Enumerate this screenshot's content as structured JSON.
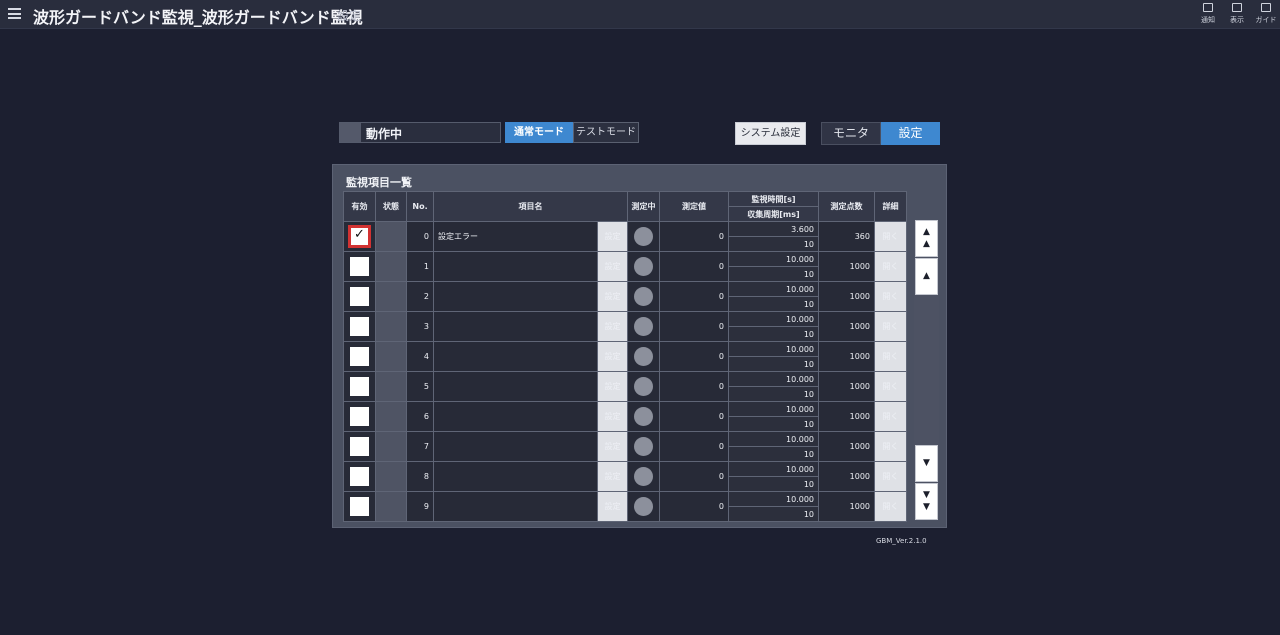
{
  "header": {
    "title": "波形ガードバンド監視_波形ガードバンド監視",
    "subtitle": "設定",
    "actions": [
      {
        "label": "通知",
        "icon": "notification-icon"
      },
      {
        "label": "表示",
        "icon": "display-icon"
      },
      {
        "label": "ガイド",
        "icon": "guide-icon"
      }
    ]
  },
  "status": {
    "text": "動作中"
  },
  "modes": {
    "normal": "通常モード",
    "test": "テストモード",
    "active": "normal"
  },
  "system_settings_label": "システム設定",
  "view_tabs": {
    "monitor": "モニタ",
    "settings": "設定",
    "active": "settings"
  },
  "panel": {
    "title": "監視項目一覧",
    "columns": {
      "enabled": "有効",
      "state": "状態",
      "no": "No.",
      "item_name": "項目名",
      "measuring": "測定中",
      "measured_value": "測定値",
      "monitor_time": "監視時間[s]",
      "sample_period": "収集周期[ms]",
      "points": "測定点数",
      "detail": "詳細"
    },
    "set_label": "設定",
    "open_label": "開く",
    "rows": [
      {
        "enabled": true,
        "no": "0",
        "name": "設定エラー",
        "value": "0",
        "monitor_time": "3.600",
        "sample_period": "10",
        "points": "360"
      },
      {
        "enabled": false,
        "no": "1",
        "name": "",
        "value": "0",
        "monitor_time": "10.000",
        "sample_period": "10",
        "points": "1000"
      },
      {
        "enabled": false,
        "no": "2",
        "name": "",
        "value": "0",
        "monitor_time": "10.000",
        "sample_period": "10",
        "points": "1000"
      },
      {
        "enabled": false,
        "no": "3",
        "name": "",
        "value": "0",
        "monitor_time": "10.000",
        "sample_period": "10",
        "points": "1000"
      },
      {
        "enabled": false,
        "no": "4",
        "name": "",
        "value": "0",
        "monitor_time": "10.000",
        "sample_period": "10",
        "points": "1000"
      },
      {
        "enabled": false,
        "no": "5",
        "name": "",
        "value": "0",
        "monitor_time": "10.000",
        "sample_period": "10",
        "points": "1000"
      },
      {
        "enabled": false,
        "no": "6",
        "name": "",
        "value": "0",
        "monitor_time": "10.000",
        "sample_period": "10",
        "points": "1000"
      },
      {
        "enabled": false,
        "no": "7",
        "name": "",
        "value": "0",
        "monitor_time": "10.000",
        "sample_period": "10",
        "points": "1000"
      },
      {
        "enabled": false,
        "no": "8",
        "name": "",
        "value": "0",
        "monitor_time": "10.000",
        "sample_period": "10",
        "points": "1000"
      },
      {
        "enabled": false,
        "no": "9",
        "name": "",
        "value": "0",
        "monitor_time": "10.000",
        "sample_period": "10",
        "points": "1000"
      }
    ]
  },
  "scroll": {
    "top": "▲\n▲",
    "up": "▲",
    "down": "▼",
    "bottom": "▼\n▼"
  },
  "version": "GBM_Ver.2.1.0",
  "colors": {
    "accent": "#3e88d0",
    "error_text": "#e04848",
    "checked_border": "#d23232"
  }
}
